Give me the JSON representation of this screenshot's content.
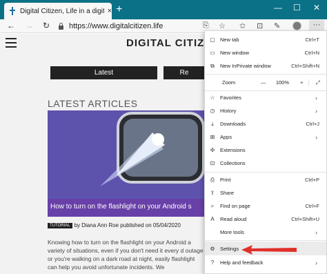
{
  "tab": {
    "title": "Digital Citizen, Life in a digital wo",
    "close": "×"
  },
  "window": {
    "new_tab": "+",
    "minimize": "—",
    "maximize": "☐",
    "close": "✕"
  },
  "nav": {
    "back": "←",
    "forward": "→",
    "refresh": "↻",
    "url": "https://www.digitalcitizen.life",
    "more": "···"
  },
  "page": {
    "logo": "DIGITAL CITIZE",
    "buttons": [
      "Latest",
      "Re"
    ],
    "section_title": "LATEST ARTICLES",
    "article": {
      "caption": "How to turn on the flashlight on your Android s",
      "badge": "TUTORIAL",
      "byline": "by Diana Ann Roe published on 05/04/2020",
      "excerpt": "Knowing how to turn on the flashlight on your Android a variety of situations, even if you don't need it every d outage or you're walking on a dark road at night, easily flashlight can help you avoid unfortunate incidents. We"
    }
  },
  "menu": {
    "items": [
      {
        "label": "New tab",
        "shortcut": "Ctrl+T",
        "icon": "new-tab-icon",
        "glyph": "▢"
      },
      {
        "label": "New window",
        "shortcut": "Ctrl+N",
        "icon": "new-window-icon",
        "glyph": "▭"
      },
      {
        "label": "New InPrivate window",
        "shortcut": "Ctrl+Shift+N",
        "icon": "inprivate-icon",
        "glyph": "⧉"
      },
      {
        "label": "Favorites",
        "shortcut": "",
        "icon": "favorites-icon",
        "glyph": "☆"
      },
      {
        "label": "History",
        "shortcut": "",
        "icon": "history-icon",
        "glyph": "◷"
      },
      {
        "label": "Downloads",
        "shortcut": "Ctrl+J",
        "icon": "downloads-icon",
        "glyph": "⤓"
      },
      {
        "label": "Apps",
        "shortcut": "",
        "icon": "apps-icon",
        "glyph": "⊞"
      },
      {
        "label": "Extensions",
        "shortcut": "",
        "icon": "extensions-icon",
        "glyph": "✣"
      },
      {
        "label": "Collections",
        "shortcut": "",
        "icon": "collections-icon",
        "glyph": "⊡"
      },
      {
        "label": "Print",
        "shortcut": "Ctrl+P",
        "icon": "print-icon",
        "glyph": "⎙"
      },
      {
        "label": "Share",
        "shortcut": "",
        "icon": "share-icon",
        "glyph": "⇪"
      },
      {
        "label": "Find on page",
        "shortcut": "Ctrl+F",
        "icon": "find-icon",
        "glyph": "⌕"
      },
      {
        "label": "Read aloud",
        "shortcut": "Ctrl+Shift+U",
        "icon": "read-aloud-icon",
        "glyph": "A"
      },
      {
        "label": "More tools",
        "shortcut": "",
        "icon": "more-tools-icon",
        "glyph": ""
      },
      {
        "label": "Settings",
        "shortcut": "",
        "icon": "settings-icon",
        "glyph": "⚙"
      },
      {
        "label": "Help and feedback",
        "shortcut": "",
        "icon": "help-icon",
        "glyph": "?"
      }
    ],
    "zoom": {
      "label": "Zoom",
      "minus": "—",
      "value": "100%",
      "plus": "+",
      "fullscreen": "⤢"
    }
  },
  "colors": {
    "title_bar": "#0b7186",
    "arrow": "#e0302a",
    "caption_bg": "#6840a8"
  }
}
